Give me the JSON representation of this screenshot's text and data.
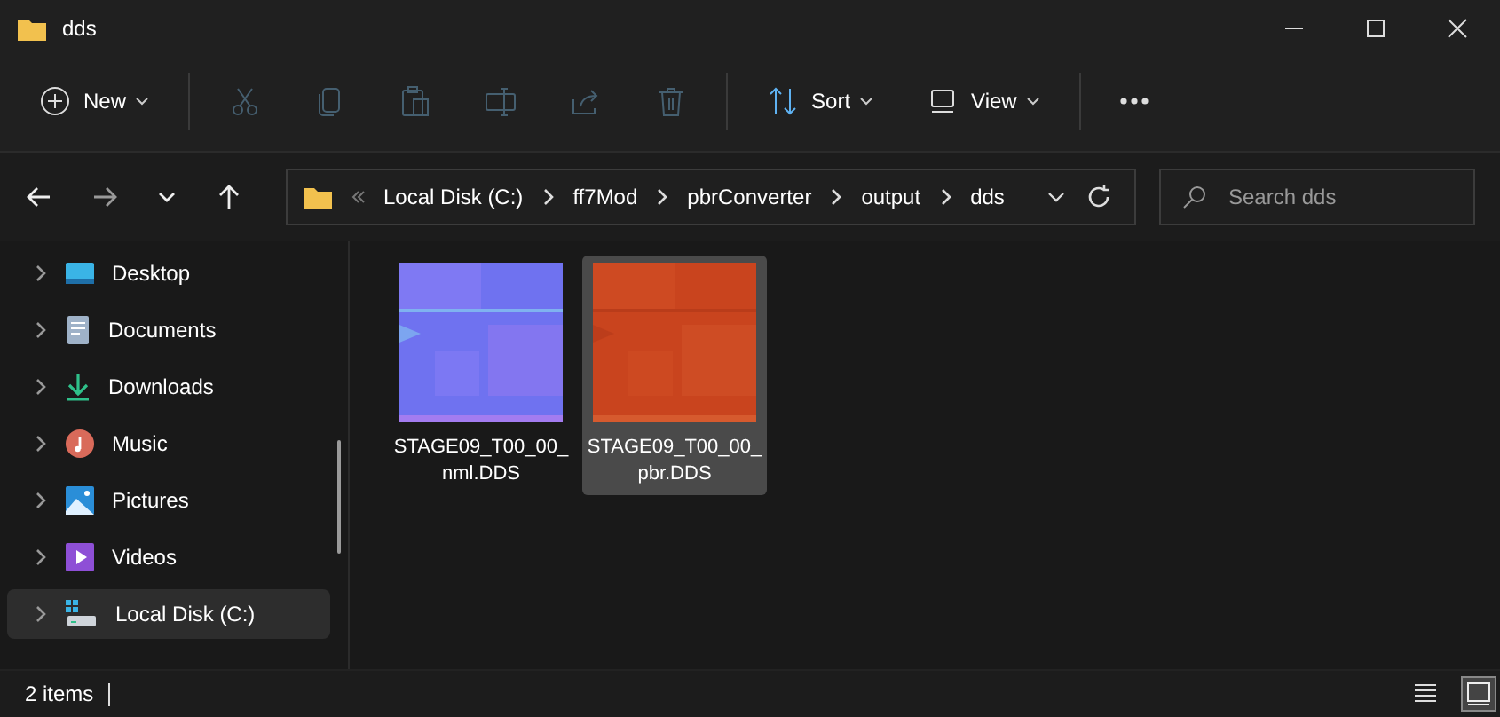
{
  "window": {
    "title": "dds"
  },
  "toolbar": [
    {
      "kind": "new",
      "label": "New",
      "disabled": false
    },
    {
      "kind": "cut",
      "disabled": true
    },
    {
      "kind": "copy",
      "disabled": true
    },
    {
      "kind": "paste",
      "disabled": true
    },
    {
      "kind": "rename",
      "disabled": true
    },
    {
      "kind": "share",
      "disabled": true
    },
    {
      "kind": "delete",
      "disabled": true
    },
    {
      "kind": "sort",
      "label": "Sort",
      "disabled": false
    },
    {
      "kind": "view",
      "label": "View",
      "disabled": false
    },
    {
      "kind": "more",
      "disabled": false
    }
  ],
  "address": {
    "crumbs": [
      "Local Disk (C:)",
      "ff7Mod",
      "pbrConverter",
      "output",
      "dds"
    ]
  },
  "search": {
    "placeholder": "Search dds"
  },
  "sidebar": {
    "items": [
      {
        "kind": "desktop",
        "label": "Desktop",
        "selected": false
      },
      {
        "kind": "documents",
        "label": "Documents",
        "selected": false
      },
      {
        "kind": "downloads",
        "label": "Downloads",
        "selected": false
      },
      {
        "kind": "music",
        "label": "Music",
        "selected": false
      },
      {
        "kind": "pictures",
        "label": "Pictures",
        "selected": false
      },
      {
        "kind": "videos",
        "label": "Videos",
        "selected": false
      },
      {
        "kind": "disk",
        "label": "Local Disk (C:)",
        "selected": true
      }
    ]
  },
  "files": [
    {
      "name": "STAGE09_T00_00_ nml.DDS",
      "kind": "picture",
      "selected": false
    },
    {
      "name": "STAGE09_T00_00_ pbr.DDS",
      "kind": "picture",
      "selected": true
    }
  ],
  "status_bar": {
    "count": "2 items",
    "views": [
      {
        "kind": "details",
        "selected": false
      },
      {
        "kind": "large-icons",
        "selected": true
      }
    ]
  }
}
